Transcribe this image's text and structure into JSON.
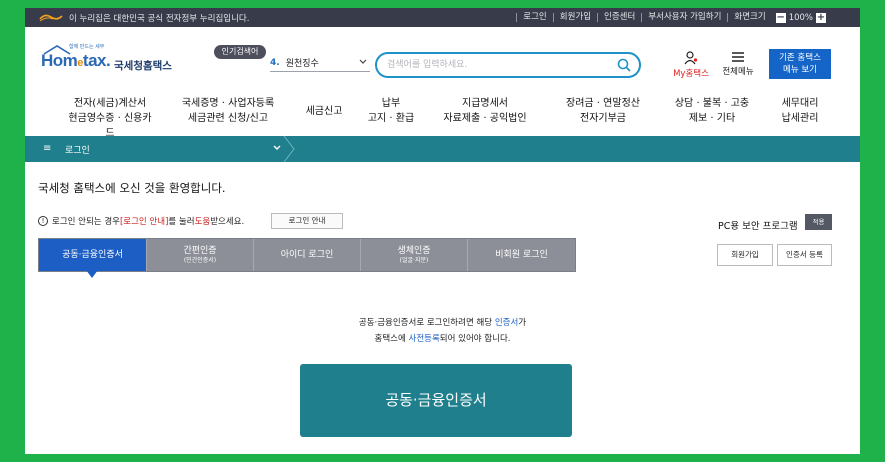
{
  "govbar": {
    "notice": "이 누리집은 대한민국 공식 전자정부 누리집입니다.",
    "links": [
      "로그인",
      "회원가입",
      "인증센터",
      "부서사용자 가입하기",
      "화면크기"
    ],
    "zoom": "100%",
    "zoom_minus": "−",
    "zoom_plus": "+"
  },
  "header": {
    "logo_slogan": "함께 만드는 세무",
    "logo_brand_a": "Hom",
    "logo_brand_e": "e",
    "logo_brand_b": "tax.",
    "logo_name": "국세청홈택스",
    "popular_label": "인기검색어",
    "popular_num": "4.",
    "popular_term": "원천징수",
    "search_placeholder": "검색어를 입력하세요.",
    "myhome_label": "My홈택스",
    "allmenu_label": "전체메뉴",
    "oldhome_line1": "기존 홈택스",
    "oldhome_line2": "메뉴 보기"
  },
  "mainnav": [
    {
      "l1": "전자(세금)계산서",
      "l2": "현금영수증 · 신용카드"
    },
    {
      "l1": "국세증명 · 사업자등록",
      "l2": "세금관련 신청/신고"
    },
    {
      "l1": "세금신고",
      "l2": ""
    },
    {
      "l1": "납부",
      "l2": "고지 · 환급"
    },
    {
      "l1": "지급명세서",
      "l2": "자료제출 · 공익법인"
    },
    {
      "l1": "장려금 · 연말정산",
      "l2": "전자기부금"
    },
    {
      "l1": "상담 · 불복 · 고충",
      "l2": "제보 · 기타"
    },
    {
      "l1": "세무대리",
      "l2": "납세관리"
    }
  ],
  "crumb": {
    "label": "로그인"
  },
  "main": {
    "welcome": "국세청 홈택스에 오신 것을 환영합니다.",
    "notice_a": "로그인 안되는 경우 ",
    "notice_red": "[로그인 안내]",
    "notice_b": "를 눌러 ",
    "notice_red2": "도움",
    "notice_c": "받으세요.",
    "login_guide_btn": "로그인 안내",
    "pc_security": "PC용 보안 프로그램",
    "install_btn": "적용",
    "tabs": [
      {
        "label": "공동·금융인증서",
        "sub": ""
      },
      {
        "label": "간편인증",
        "sub": "(민간인증서)"
      },
      {
        "label": "아이디 로그인",
        "sub": ""
      },
      {
        "label": "생체인증",
        "sub": "(얼굴·지문)"
      },
      {
        "label": "비회원 로그인",
        "sub": ""
      }
    ],
    "signup_btn": "회원가입",
    "cert_register_btn": "인증서 등록",
    "desc1_a": "공동·금융인증서로 로그인하려면 해당 ",
    "desc1_blue": "인증서",
    "desc1_b": "가",
    "desc2_a": "홈택스에 ",
    "desc2_blue": "사전등록",
    "desc2_b": "되어 있어야 합니다.",
    "cert_login_btn": "공동·금융인증서"
  },
  "colors": {
    "frame_bg": "#20b24a",
    "teal": "#1f7f8c",
    "active_tab": "#1d5ec5",
    "search_border": "#1e92c9"
  }
}
